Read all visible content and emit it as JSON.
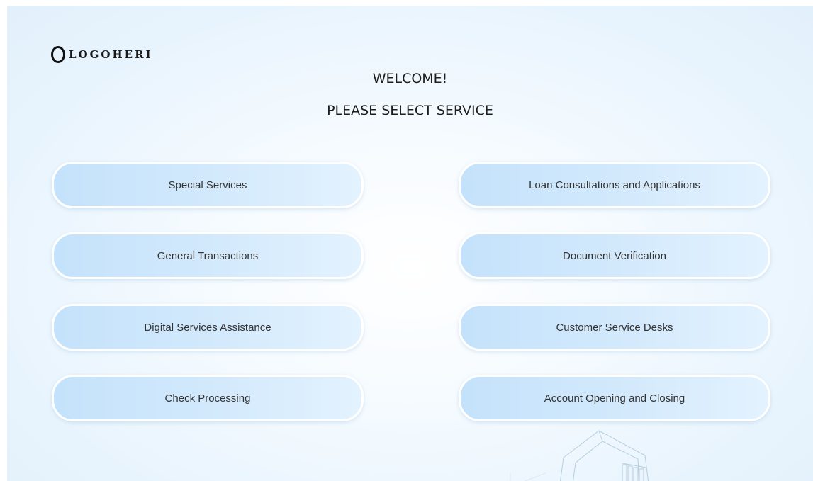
{
  "brand": {
    "logo_text": "LOGOHERI"
  },
  "header": {
    "welcome": "WELCOME!",
    "instruction": "PLEASE SELECT SERVICE"
  },
  "services": {
    "left": [
      {
        "label": "Special Services"
      },
      {
        "label": "General Transactions"
      },
      {
        "label": "Digital Services Assistance"
      },
      {
        "label": "Check Processing"
      }
    ],
    "right": [
      {
        "label": "Loan Consultations and Applications"
      },
      {
        "label": "Document Verification"
      },
      {
        "label": "Customer Service Desks"
      },
      {
        "label": "Account Opening and Closing"
      }
    ]
  },
  "colors": {
    "button_start": "#c4e2fb",
    "button_end": "#e3f2fe",
    "background": "#e8f4fd",
    "text": "#333333"
  }
}
